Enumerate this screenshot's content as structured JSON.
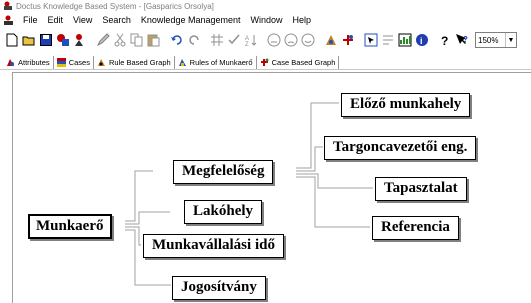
{
  "window": {
    "title": "Doctus Knowledge Based System - [Gasparics Orsolya]"
  },
  "menu": {
    "items": [
      "File",
      "Edit",
      "View",
      "Search",
      "Knowledge Management",
      "Window",
      "Help"
    ]
  },
  "toolbar": {
    "zoom_value": "150%"
  },
  "tabs": [
    {
      "label": "Attributes",
      "icon": "attributes-icon"
    },
    {
      "label": "Cases",
      "icon": "cases-icon"
    },
    {
      "label": "Rule Based Graph",
      "icon": "rule-graph-icon",
      "active": true
    },
    {
      "label": "Rules of Munkaerő",
      "icon": "rules-icon"
    },
    {
      "label": "Case Based Graph",
      "icon": "case-graph-icon"
    }
  ],
  "graph": {
    "root": "Munkaerő",
    "children": [
      "Megfelelőség",
      "Lakóhely",
      "Munkavállalási idő",
      "Jogosítvány"
    ],
    "megfeleloseg_children": [
      "Előző munkahely",
      "Targoncavezetői eng.",
      "Tapasztalat",
      "Referencia"
    ]
  },
  "colors": {
    "edge": "#a0a0a0",
    "node_shadow": "#808080",
    "title_text": "#7f7f7f"
  }
}
